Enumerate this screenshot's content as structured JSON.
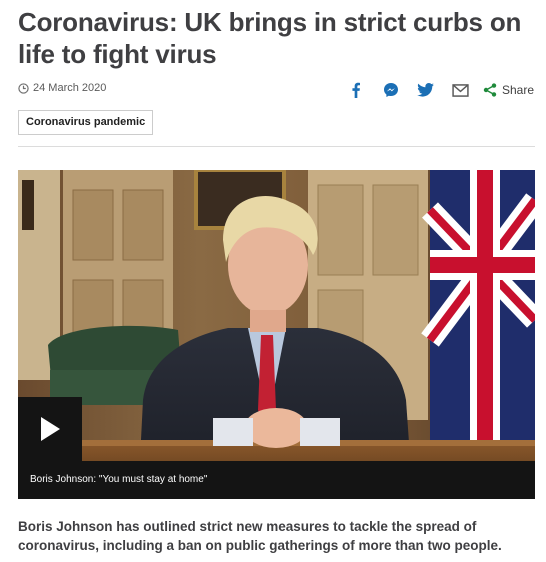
{
  "article": {
    "headline": "Coronavirus: UK brings in strict curbs on life to fight virus",
    "date": "24 March 2020",
    "date_icon": "clock-icon",
    "tag": "Coronavirus pandemic",
    "summary": "Boris Johnson has outlined strict new measures to tackle the spread of coronavirus, including a ban on public gatherings of more than two people."
  },
  "share": {
    "icons": [
      "facebook-icon",
      "messenger-icon",
      "twitter-icon",
      "email-icon",
      "share-icon"
    ],
    "label": "Share",
    "accent_color": "#1b6fb5"
  },
  "video": {
    "caption": "Boris Johnson: \"You must stay at home\"",
    "play_icon": "play-icon"
  }
}
